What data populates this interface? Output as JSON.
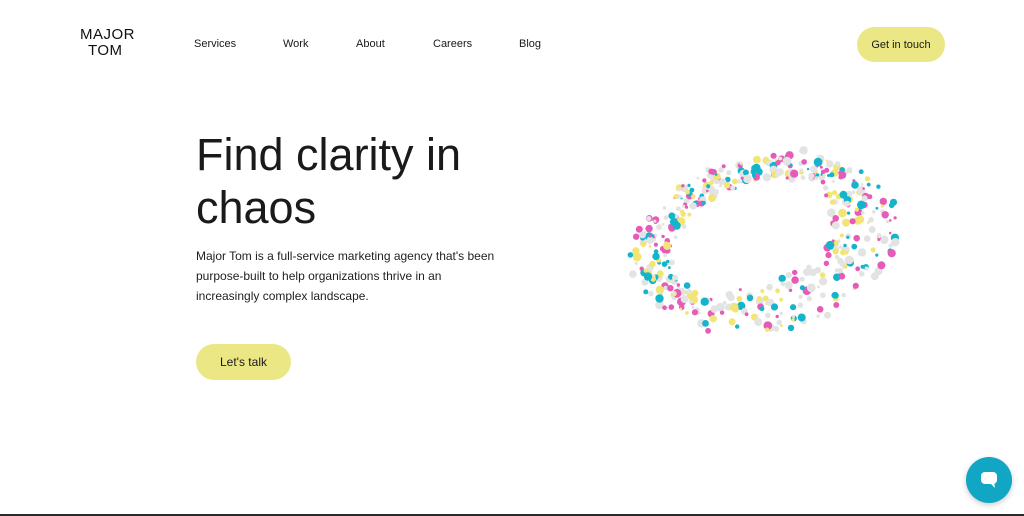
{
  "header": {
    "logo_line1": "MAJOR",
    "logo_line2": "TOM",
    "nav": [
      "Services",
      "Work",
      "About",
      "Careers",
      "Blog"
    ],
    "cta_label": "Get in touch"
  },
  "hero": {
    "title": "Find clarity in chaos",
    "description": "Major Tom is a full-service marketing agency that's been purpose-built to help organizations thrive in an increasingly complex landscape.",
    "cta_label": "Let's talk"
  },
  "colors": {
    "accent_yellow": "#ece785",
    "chat_teal": "#10a6c4",
    "dot_pink": "#e65bb8",
    "dot_cyan": "#14b4cc",
    "dot_yellow": "#f2e574",
    "dot_grey": "#e3e3e3"
  },
  "icons": {
    "chat": "chat-bubble-icon"
  }
}
